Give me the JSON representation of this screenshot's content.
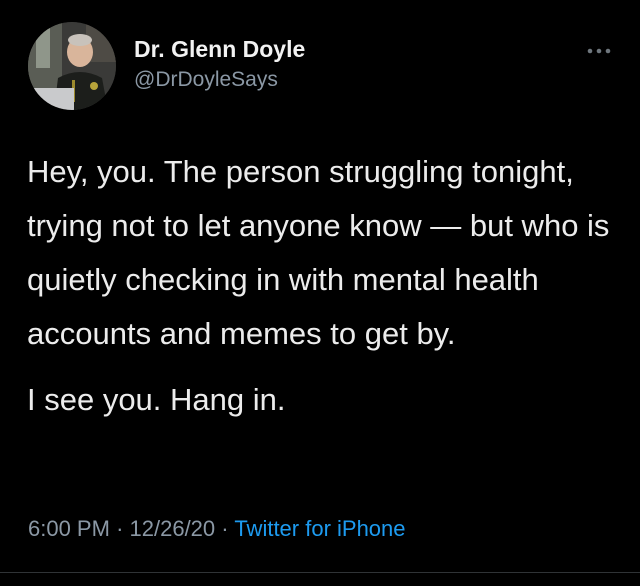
{
  "author": {
    "name": "Dr. Glenn Doyle",
    "handle": "@DrDoyleSays",
    "avatar_icon": "profile-photo"
  },
  "menu_icon": "more-dots-icon",
  "tweet": {
    "paragraph_1": "Hey, you. The person struggling tonight, trying not to let anyone know — but who is quietly checking in with mental health accounts and memes to get by.",
    "paragraph_2": "I see you. Hang in."
  },
  "meta": {
    "time": "6:00 PM",
    "separator": "·",
    "date": "12/26/20",
    "source": "Twitter for iPhone"
  },
  "colors": {
    "background": "#000000",
    "text": "#ececec",
    "secondary": "#8b98a5",
    "link": "#1d9bf0"
  }
}
